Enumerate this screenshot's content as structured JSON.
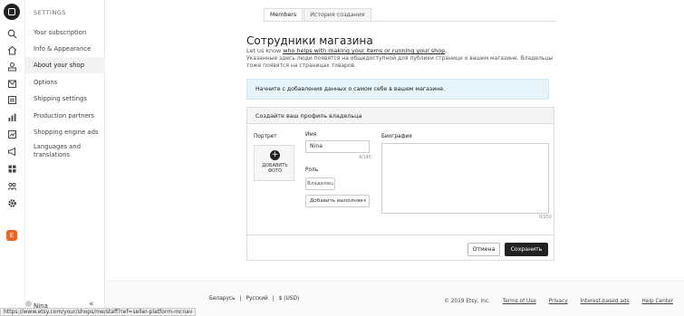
{
  "rail": {
    "icons": [
      "etsy-logo-icon",
      "search-icon",
      "home-icon",
      "listings-icon",
      "orders-icon",
      "messages-icon",
      "stats-icon",
      "marketing-icon",
      "megaphone-icon",
      "integrations-icon",
      "community-icon",
      "settings-icon",
      "etsy-badge-icon"
    ],
    "badge_letter": "E",
    "badge_color": "#f1641e"
  },
  "nav": {
    "header": "SETTINGS",
    "items": [
      {
        "label": "Your subscription"
      },
      {
        "label": "Info & Appearance"
      },
      {
        "label": "About your shop"
      },
      {
        "label": "Options"
      },
      {
        "label": "Shipping settings"
      },
      {
        "label": "Production partners"
      },
      {
        "label": "Shopping engine ads"
      },
      {
        "label": "Languages and translations"
      }
    ],
    "user_name": "Nina",
    "collapse_glyph": "«"
  },
  "tabs": [
    {
      "label": "Members"
    },
    {
      "label": "История создания"
    }
  ],
  "page": {
    "title": "Сотрудники магазина",
    "subtitle_prefix": "Let us know ",
    "subtitle_link": "who helps with making your items or running your shop",
    "subtitle_suffix": ".",
    "description": "Указанные здесь люди появятся на общедоступной для публики странице о вашем магазине. Владельцы тоже появятся на страницах товаров.",
    "info_banner": "Начните с добавления данных о самом себе в вашем магазине."
  },
  "card": {
    "header": "Создайте ваш профиль владельца",
    "portrait_label": "Портрет",
    "add_photo_line1": "ДОБАВИТЬ",
    "add_photo_line2": "ФОТО",
    "name_label": "Имя",
    "name_value": "Nina",
    "name_counter": "4/140",
    "role_label": "Роль",
    "role_button": "Владелец",
    "role_select": "Добавить выполняе",
    "bio_label": "Биография",
    "bio_counter": "0/250",
    "cancel_label": "Отмена",
    "save_label": "Сохранить"
  },
  "footer": {
    "region": "Беларусь",
    "language": "Русский",
    "currency": "$ (USD)",
    "copyright": "© 2019 Etsy, Inc.",
    "links": [
      "Terms of Use",
      "Privacy",
      "Interest-based ads",
      "Help Center"
    ]
  },
  "status_url": "https://www.etsy.com/your/shops/me/staff?ref=seller-platform-mcnav"
}
